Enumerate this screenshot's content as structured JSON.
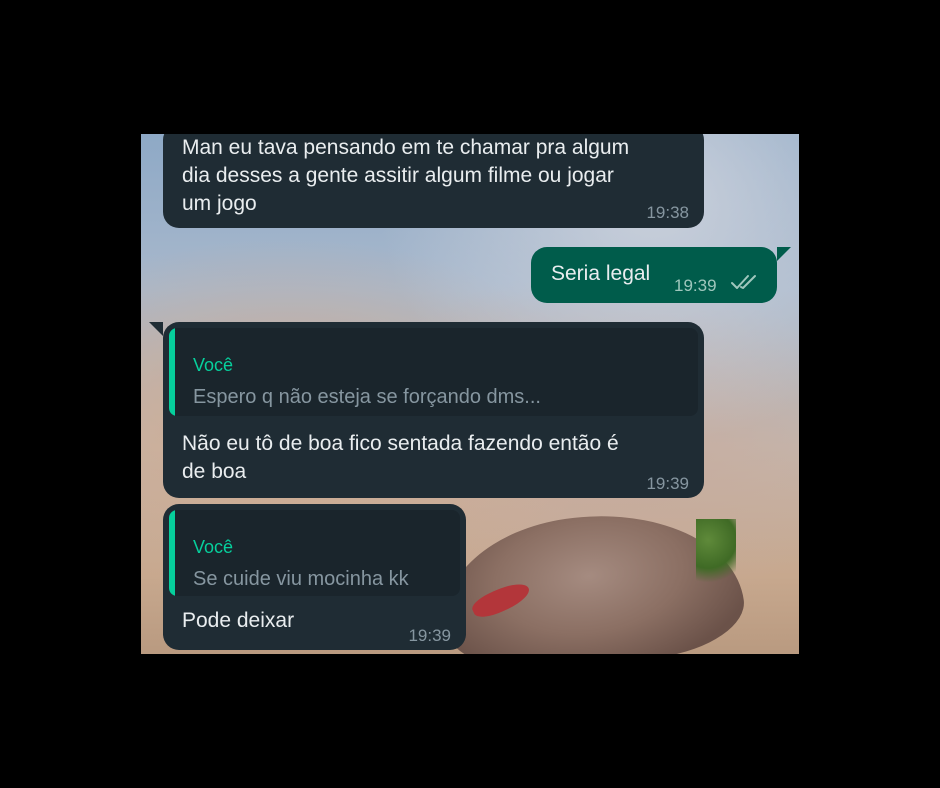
{
  "messages": [
    {
      "direction": "in",
      "lines": [
        "Man eu tava pensando em te chamar pra algum",
        "dia desses a gente assitir algum filme ou jogar",
        "um jogo"
      ],
      "time": "19:38"
    },
    {
      "direction": "out",
      "text": "Seria legal",
      "time": "19:39",
      "status_icon": "double-check-icon"
    },
    {
      "direction": "in",
      "quote": {
        "author": "Você",
        "text": "Espero q não esteja se forçando dms..."
      },
      "lines": [
        "Não eu tô de boa fico sentada fazendo então é",
        "de boa"
      ],
      "time": "19:39"
    },
    {
      "direction": "in",
      "quote": {
        "author": "Você",
        "text": "Se cuide viu mocinha kk"
      },
      "lines": [
        "Pode deixar"
      ],
      "time": "19:39"
    }
  ],
  "colors": {
    "incoming_bubble": "#1f2c34",
    "outgoing_bubble": "#005c4b",
    "quote_accent": "#06cf9c",
    "timestamp": "#8696a0"
  }
}
